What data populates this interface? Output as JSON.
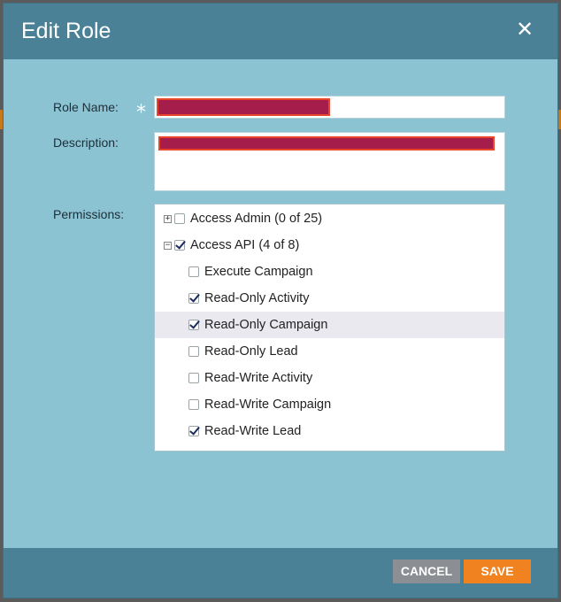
{
  "dialog": {
    "title": "Edit Role",
    "close_glyph": "✕"
  },
  "form": {
    "role_name_label": "Role Name:",
    "required_marker": "*",
    "description_label": "Description:",
    "permissions_label": "Permissions:"
  },
  "permissions": [
    {
      "expander": "+",
      "label": "Access Admin (0 of 25)",
      "checked": false,
      "level": 0
    },
    {
      "expander": "−",
      "label": "Access API (4 of 8)",
      "checked": true,
      "level": 0
    },
    {
      "label": "Execute Campaign",
      "checked": false,
      "level": 1
    },
    {
      "label": "Read-Only Activity",
      "checked": true,
      "level": 1
    },
    {
      "label": "Read-Only Campaign",
      "checked": true,
      "level": 1,
      "highlighted": true
    },
    {
      "label": "Read-Only Lead",
      "checked": false,
      "level": 1
    },
    {
      "label": "Read-Write Activity",
      "checked": false,
      "level": 1
    },
    {
      "label": "Read-Write Campaign",
      "checked": false,
      "level": 1
    },
    {
      "label": "Read-Write Lead",
      "checked": true,
      "level": 1
    }
  ],
  "footer": {
    "cancel_label": "CANCEL",
    "save_label": "SAVE"
  },
  "colors": {
    "header": "#4a8197",
    "body": "#8bc3d3",
    "save": "#f08220",
    "cancel": "#8b8f93",
    "redaction": "#a51d4b"
  }
}
